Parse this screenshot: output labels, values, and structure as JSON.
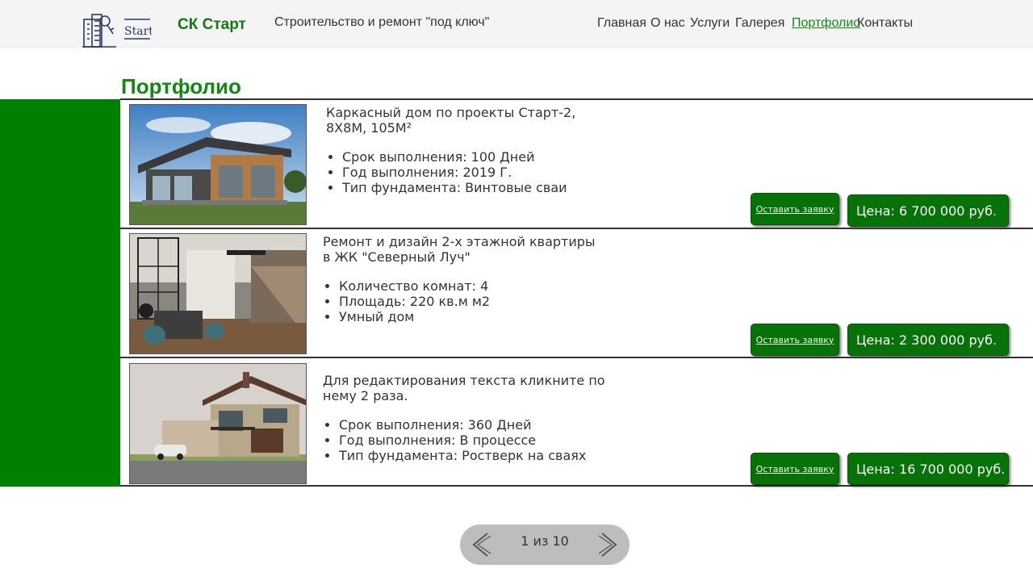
{
  "header": {
    "logo_text": "Start",
    "brand": "СК Старт",
    "tagline": "Строительство и ремонт \"под ключ\"",
    "nav": [
      {
        "label": "Главная"
      },
      {
        "label": "О нас"
      },
      {
        "label": "Услуги"
      },
      {
        "label": "Галерея"
      },
      {
        "label": "Портфолио",
        "active": true
      },
      {
        "label": "Контакты"
      }
    ]
  },
  "page": {
    "title": "Портфолио"
  },
  "projects": [
    {
      "title": "Каркасный дом по проекты Старт-2, 8Х8М, 105М²",
      "bullets": [
        "Срок выполнения: 100 Дней",
        "Год выполнения: 2019 Г.",
        "Тип фундамента: Винтовые сваи"
      ],
      "request_label": "Оставить заявку",
      "price": "Цена: 6 700 000 руб.",
      "image": "modern-frame-house-photo"
    },
    {
      "title": "Ремонт и дизайн 2-х этажной квартиры в ЖК \"Северный Луч\"",
      "bullets": [
        "Количество комнат: 4",
        "Площадь: 220 кв.м м2",
        "Умный дом"
      ],
      "request_label": "Оставить заявку",
      "price": "Цена: 2 300 000 руб.",
      "image": "apartment-interior-photo"
    },
    {
      "title": "Для редактирования текста кликните по нему 2 раза.",
      "bullets": [
        "Срок выполнения: 360 Дней",
        "Год выполнения: В процессе",
        "Тип фундамента: Ростверк на сваях"
      ],
      "request_label": "Оставить заявку",
      "price": "Цена: 16 700 000 руб.",
      "image": "two-storey-house-photo"
    }
  ],
  "pager": {
    "counter": "1 из 10"
  },
  "colors": {
    "accent": "#008000",
    "button": "#077207",
    "header_bg": "#f4f4f4",
    "pager_bg": "#bdbdbd"
  }
}
